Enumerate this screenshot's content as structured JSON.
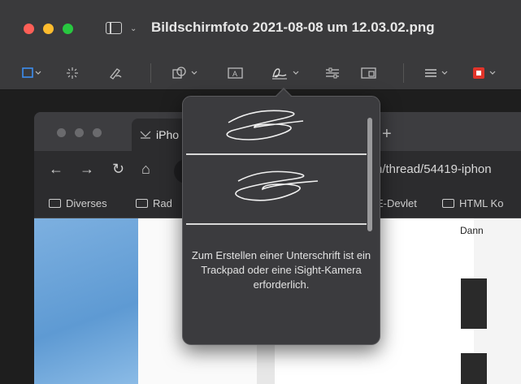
{
  "window": {
    "title": "Bildschirmfoto 2021-08-08 um 12.03.02.png"
  },
  "toolbar": {
    "icons": [
      "selection-icon",
      "instant-alpha-icon",
      "sketch-icon",
      "shapes-icon",
      "textbox-icon",
      "signature-icon",
      "adjust-color-icon",
      "adjust-size-icon",
      "line-style-icon",
      "border-color-icon"
    ],
    "border_color": "#e0342a"
  },
  "browser": {
    "tab_title": "iPho",
    "url": "n/thread/54419-iphon",
    "bookmarks": [
      "Diverses",
      "Rad",
      "E-Devlet",
      "HTML Ko"
    ],
    "sidebar_caption": "Dann"
  },
  "signature_popover": {
    "message": "Zum Erstellen einer Unterschrift ist ein Trackpad oder eine iSight-Kamera erforderlich."
  }
}
